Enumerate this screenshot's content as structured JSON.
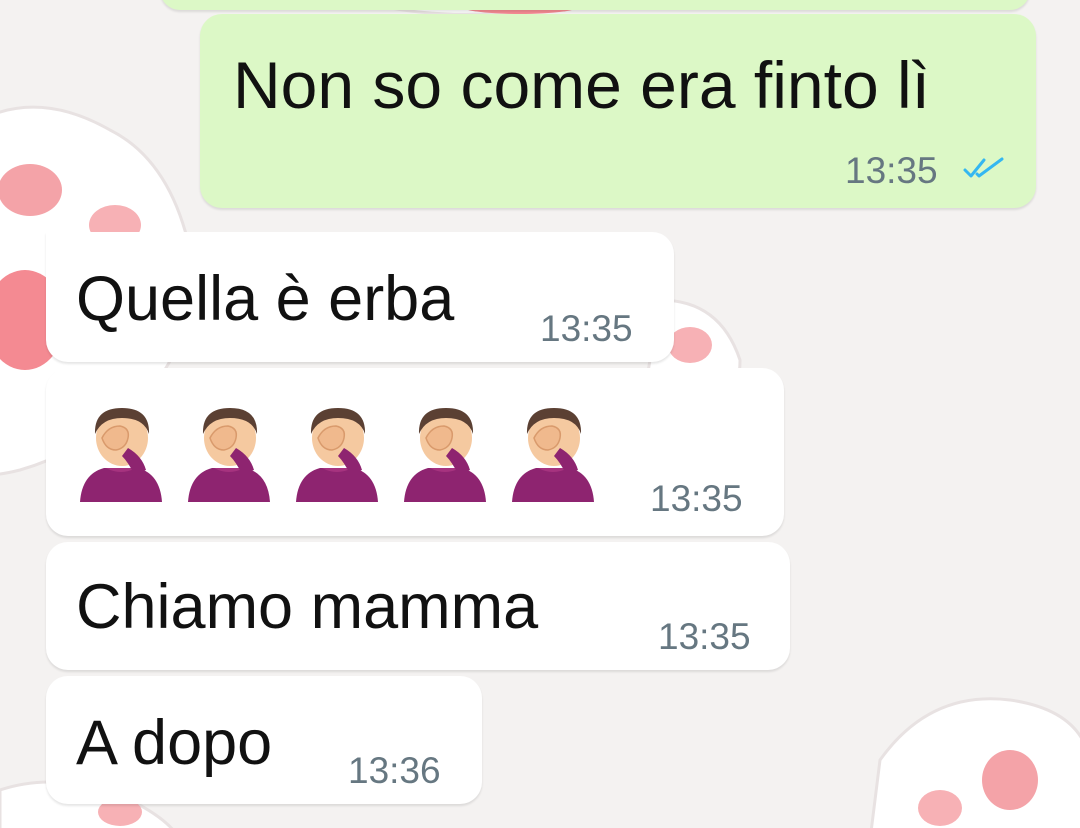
{
  "chat": {
    "messages": [
      {
        "direction": "outgoing",
        "text": "Non so come era finto lì",
        "time": "13:35",
        "status_icon": "double-check-icon",
        "status_color": "#34b7f1"
      },
      {
        "direction": "incoming",
        "text": "Quella è erba",
        "time": "13:35"
      },
      {
        "direction": "incoming",
        "emoji": "man-facepalming-icon",
        "emoji_count": 5,
        "time": "13:35"
      },
      {
        "direction": "incoming",
        "text": "Chiamo mamma",
        "time": "13:35"
      },
      {
        "direction": "incoming",
        "text": "A dopo",
        "time": "13:36"
      }
    ]
  },
  "colors": {
    "outgoing_bubble": "#dcf8c6",
    "incoming_bubble": "#ffffff",
    "time_text": "#667781",
    "wallpaper_paw": "#f48a92"
  }
}
